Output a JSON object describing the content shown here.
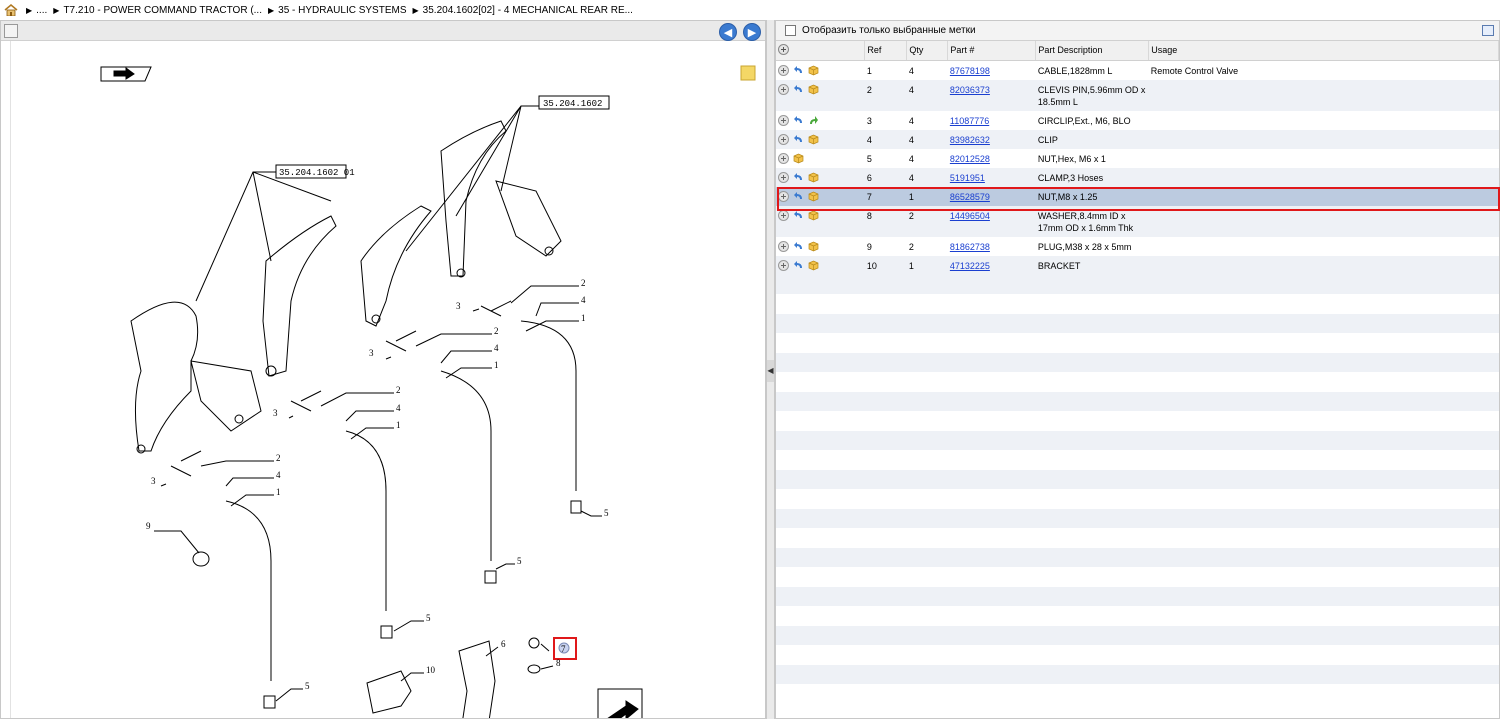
{
  "breadcrumb": {
    "home_icon": "home-icon",
    "items": [
      "....",
      "T7.210 - POWER COMMAND TRACTOR (...",
      "35 - HYDRAULIC SYSTEMS",
      "35.204.1602[02] - 4 MECHANICAL REAR RE..."
    ]
  },
  "left_panel": {
    "nav_back_icon": "arrow-left-icon",
    "nav_forward_icon": "arrow-right-icon",
    "drawing": {
      "ref_labels": [
        "35.204.1602",
        "35.204.1602  01"
      ],
      "callouts": [
        "2",
        "4",
        "3",
        "1",
        "2",
        "4",
        "3",
        "1",
        "2",
        "4",
        "3",
        "1",
        "2",
        "4",
        "3",
        "1",
        "5",
        "5",
        "5",
        "5",
        "9",
        "6",
        "7",
        "8",
        "10"
      ]
    }
  },
  "right_panel": {
    "filter_label": "Отобразить только выбранные метки",
    "columns": [
      "Ref",
      "Qty",
      "Part #",
      "Part Description",
      "Usage"
    ],
    "rows": [
      {
        "ref": "1",
        "qty": "4",
        "part": "87678198",
        "desc": "CABLE,1828mm L",
        "usage": "Remote Control Valve"
      },
      {
        "ref": "2",
        "qty": "4",
        "part": "82036373",
        "desc": "CLEVIS PIN,5.96mm OD x 18.5mm L",
        "usage": ""
      },
      {
        "ref": "3",
        "qty": "4",
        "part": "11087776",
        "desc": "CIRCLIP,Ext., M6, BLO",
        "usage": ""
      },
      {
        "ref": "4",
        "qty": "4",
        "part": "83982632",
        "desc": "CLIP",
        "usage": ""
      },
      {
        "ref": "5",
        "qty": "4",
        "part": "82012528",
        "desc": "NUT,Hex, M6 x 1",
        "usage": ""
      },
      {
        "ref": "6",
        "qty": "4",
        "part": "5191951",
        "desc": "CLAMP,3 Hoses",
        "usage": ""
      },
      {
        "ref": "7",
        "qty": "1",
        "part": "86528579",
        "desc": "NUT,M8 x 1.25",
        "usage": ""
      },
      {
        "ref": "8",
        "qty": "2",
        "part": "14496504",
        "desc": "WASHER,8.4mm ID x 17mm OD x 1.6mm Thk",
        "usage": ""
      },
      {
        "ref": "9",
        "qty": "2",
        "part": "81862738",
        "desc": "PLUG,M38 x 28 x 5mm",
        "usage": ""
      },
      {
        "ref": "10",
        "qty": "1",
        "part": "47132225",
        "desc": "BRACKET",
        "usage": ""
      }
    ],
    "selected_ref": "7"
  }
}
